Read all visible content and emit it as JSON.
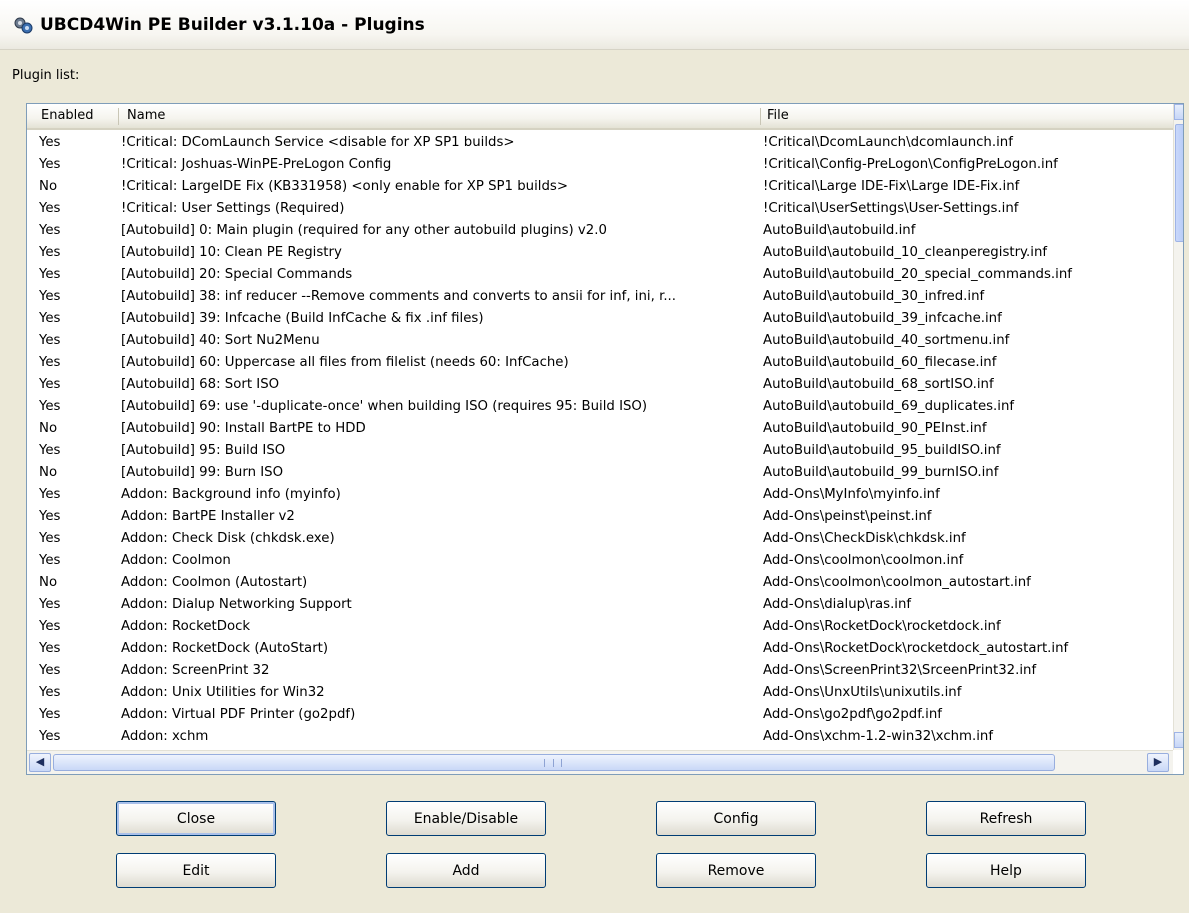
{
  "window": {
    "title": "UBCD4Win PE Builder v3.1.10a - Plugins",
    "plugin_list_label": "Plugin list:"
  },
  "columns": {
    "enabled": "Enabled",
    "name": "Name",
    "file": "File"
  },
  "rows": [
    {
      "enabled": "Yes",
      "name": "!Critical: DComLaunch Service <disable for XP SP1 builds>",
      "file": "!Critical\\DcomLaunch\\dcomlaunch.inf"
    },
    {
      "enabled": "Yes",
      "name": "!Critical: Joshuas-WinPE-PreLogon Config",
      "file": "!Critical\\Config-PreLogon\\ConfigPreLogon.inf"
    },
    {
      "enabled": "No",
      "name": "!Critical: LargeIDE Fix (KB331958) <only enable for XP SP1 builds>",
      "file": "!Critical\\Large IDE-Fix\\Large IDE-Fix.inf"
    },
    {
      "enabled": "Yes",
      "name": "!Critical: User Settings (Required)",
      "file": "!Critical\\UserSettings\\User-Settings.inf"
    },
    {
      "enabled": "Yes",
      "name": "[Autobuild] 0: Main plugin (required for any other autobuild plugins) v2.0",
      "file": "AutoBuild\\autobuild.inf"
    },
    {
      "enabled": "Yes",
      "name": "[Autobuild] 10: Clean PE Registry",
      "file": "AutoBuild\\autobuild_10_cleanperegistry.inf"
    },
    {
      "enabled": "Yes",
      "name": "[Autobuild] 20: Special Commands",
      "file": "AutoBuild\\autobuild_20_special_commands.inf"
    },
    {
      "enabled": "Yes",
      "name": "[Autobuild] 38: inf reducer --Remove comments and converts to ansii for inf, ini, r...",
      "file": "AutoBuild\\autobuild_30_infred.inf"
    },
    {
      "enabled": "Yes",
      "name": "[Autobuild] 39: Infcache (Build InfCache & fix .inf files)",
      "file": "AutoBuild\\autobuild_39_infcache.inf"
    },
    {
      "enabled": "Yes",
      "name": "[Autobuild] 40: Sort Nu2Menu",
      "file": "AutoBuild\\autobuild_40_sortmenu.inf"
    },
    {
      "enabled": "Yes",
      "name": "[Autobuild] 60: Uppercase all files from filelist (needs 60: InfCache)",
      "file": "AutoBuild\\autobuild_60_filecase.inf"
    },
    {
      "enabled": "Yes",
      "name": "[Autobuild] 68: Sort ISO",
      "file": "AutoBuild\\autobuild_68_sortISO.inf"
    },
    {
      "enabled": "Yes",
      "name": "[Autobuild] 69: use '-duplicate-once' when building ISO (requires 95: Build ISO)",
      "file": "AutoBuild\\autobuild_69_duplicates.inf"
    },
    {
      "enabled": "No",
      "name": "[Autobuild] 90: Install BartPE to HDD",
      "file": "AutoBuild\\autobuild_90_PEInst.inf"
    },
    {
      "enabled": "Yes",
      "name": "[Autobuild] 95: Build ISO",
      "file": "AutoBuild\\autobuild_95_buildISO.inf"
    },
    {
      "enabled": "No",
      "name": "[Autobuild] 99: Burn ISO",
      "file": "AutoBuild\\autobuild_99_burnISO.inf"
    },
    {
      "enabled": "Yes",
      "name": "Addon: Background info (myinfo)",
      "file": "Add-Ons\\MyInfo\\myinfo.inf"
    },
    {
      "enabled": "Yes",
      "name": "Addon: BartPE Installer v2",
      "file": "Add-Ons\\peinst\\peinst.inf"
    },
    {
      "enabled": "Yes",
      "name": "Addon: Check Disk (chkdsk.exe)",
      "file": "Add-Ons\\CheckDisk\\chkdsk.inf"
    },
    {
      "enabled": "Yes",
      "name": "Addon: Coolmon",
      "file": "Add-Ons\\coolmon\\coolmon.inf"
    },
    {
      "enabled": "No",
      "name": "Addon: Coolmon (Autostart)",
      "file": "Add-Ons\\coolmon\\coolmon_autostart.inf"
    },
    {
      "enabled": "Yes",
      "name": "Addon: Dialup Networking Support",
      "file": "Add-Ons\\dialup\\ras.inf"
    },
    {
      "enabled": "Yes",
      "name": "Addon: RocketDock",
      "file": "Add-Ons\\RocketDock\\rocketdock.inf"
    },
    {
      "enabled": "Yes",
      "name": "Addon: RocketDock (AutoStart)",
      "file": "Add-Ons\\RocketDock\\rocketdock_autostart.inf"
    },
    {
      "enabled": "Yes",
      "name": "Addon: ScreenPrint 32",
      "file": "Add-Ons\\ScreenPrint32\\SrceenPrint32.inf"
    },
    {
      "enabled": "Yes",
      "name": "Addon: Unix Utilities for Win32",
      "file": "Add-Ons\\UnxUtils\\unixutils.inf"
    },
    {
      "enabled": "Yes",
      "name": "Addon: Virtual PDF Printer (go2pdf)",
      "file": "Add-Ons\\go2pdf\\go2pdf.inf"
    },
    {
      "enabled": "Yes",
      "name": "Addon: xchm",
      "file": "Add-Ons\\xchm-1.2-win32\\xchm.inf"
    }
  ],
  "buttons": {
    "close": "Close",
    "enable_disable": "Enable/Disable",
    "config": "Config",
    "refresh": "Refresh",
    "edit": "Edit",
    "add": "Add",
    "remove": "Remove",
    "help": "Help"
  }
}
